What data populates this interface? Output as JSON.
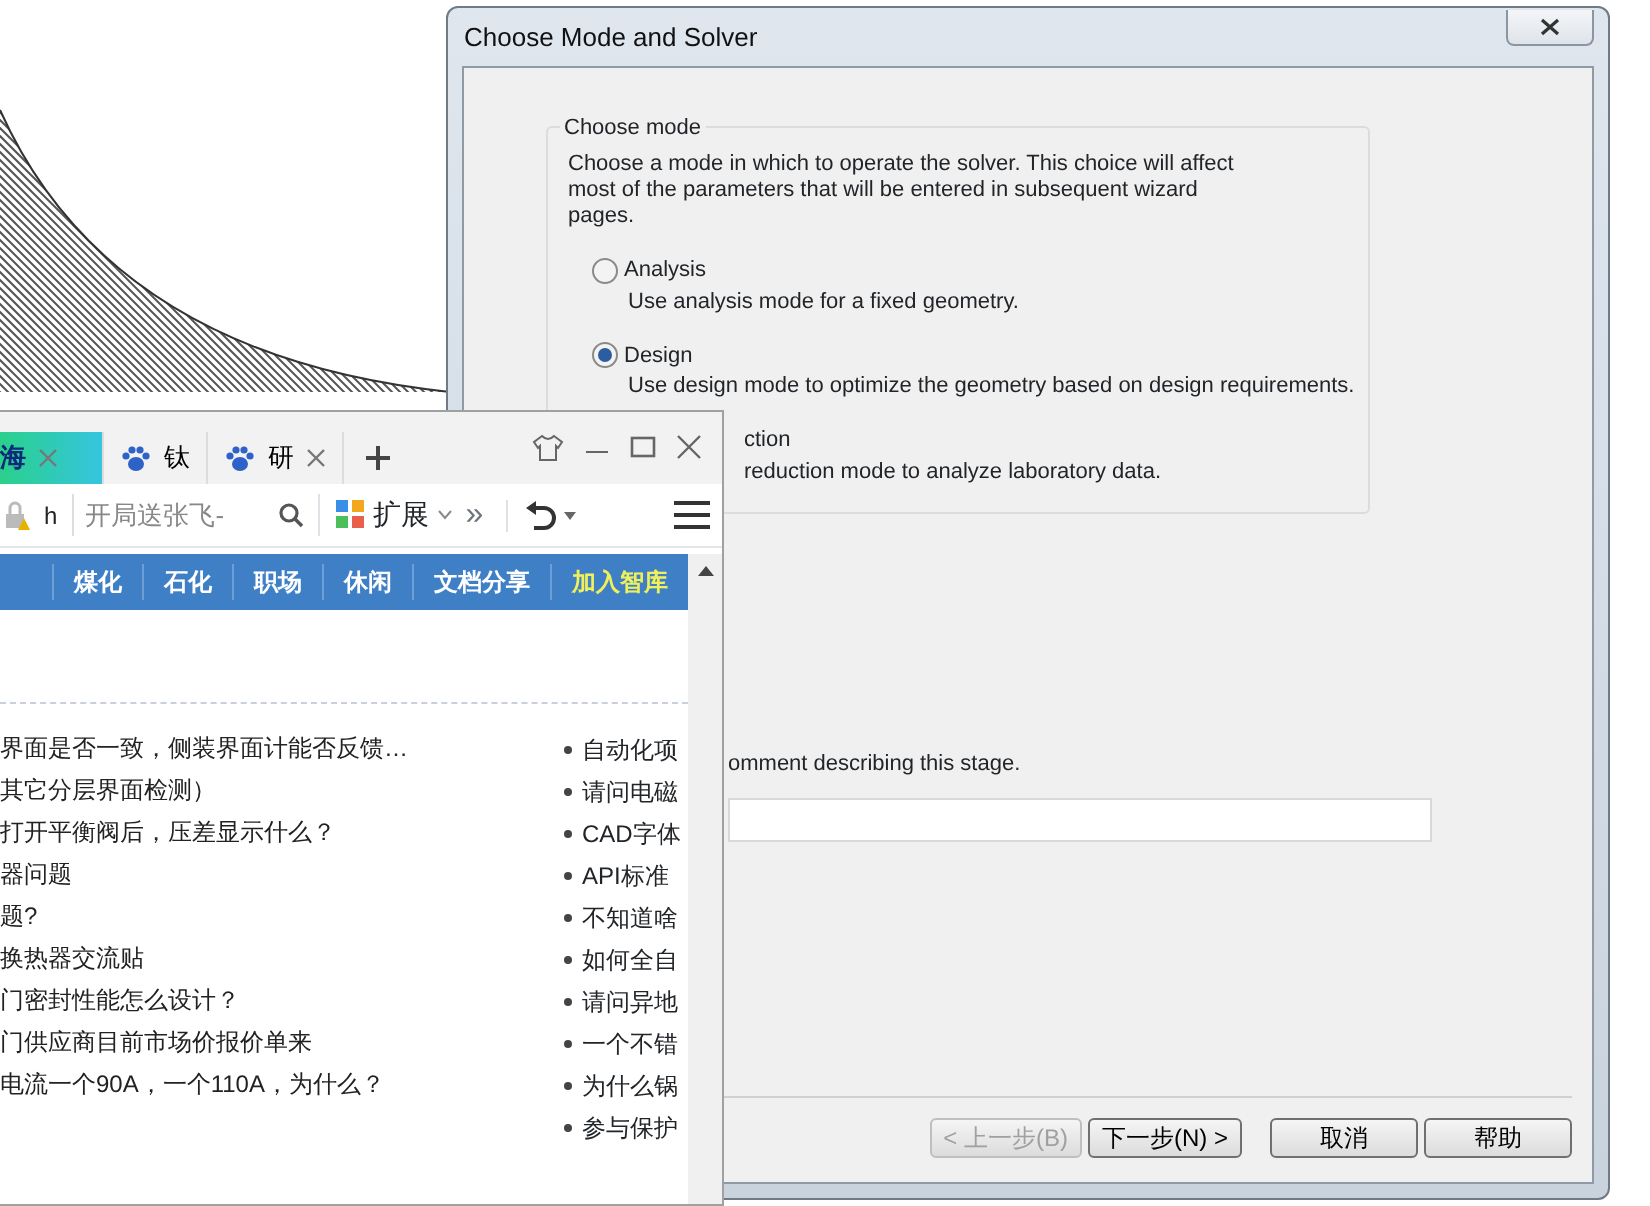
{
  "dialog": {
    "title": "Choose Mode and Solver",
    "group_title": "Choose mode",
    "description": "Choose a mode in which to operate the solver. This choice will affect most of the parameters that will be entered in subsequent wizard pages.",
    "options": [
      {
        "kind": "radio",
        "label": "Analysis",
        "description": "Use analysis mode for a fixed geometry.",
        "selected": false
      },
      {
        "kind": "radio",
        "label": "Design",
        "description": "Use design mode to optimize the geometry based on design requirements.",
        "selected": true
      },
      {
        "kind": "covered",
        "label": "ction",
        "description": "reduction mode to analyze laboratory data."
      }
    ],
    "comment_label": "omment describing this stage.",
    "buttons": [
      {
        "label": "< 上一步(B)",
        "disabled": true
      },
      {
        "label": "下一步(N) >",
        "disabled": false
      },
      {
        "label": "取消",
        "disabled": false
      },
      {
        "label": "帮助",
        "disabled": false
      }
    ]
  },
  "browser": {
    "tabs": [
      {
        "label": "海",
        "selected": true,
        "closable": true
      },
      {
        "label": "钛",
        "selected": false,
        "closable": false
      },
      {
        "label": "研",
        "selected": false,
        "closable": true
      }
    ],
    "address": "h",
    "search": {
      "placeholder": "开局送张飞-"
    },
    "extensions": "扩展",
    "more": "»",
    "nav": [
      {
        "label": "煤化",
        "highlight": false
      },
      {
        "label": "石化",
        "highlight": false
      },
      {
        "label": "职场",
        "highlight": false
      },
      {
        "label": "休闲",
        "highlight": false
      },
      {
        "label": "文档分享",
        "highlight": false
      },
      {
        "label": "加入智库",
        "highlight": true
      }
    ],
    "left_items": [
      "界面是否一致，侧装界面计能否反馈…",
      "其它分层界面检测）",
      "打开平衡阀后，压差显示什么？",
      "器问题",
      "题?",
      "换热器交流贴",
      "门密封性能怎么设计？",
      "门供应商目前市场价报价单来",
      "电流一个90A，一个110A，为什么？"
    ],
    "right_items": [
      "自动化项",
      "请问电磁",
      "CAD字体",
      "API标准",
      "不知道啥",
      "如何全自",
      "请问异地",
      "一个不错",
      "为什么锅",
      "参与保护"
    ]
  }
}
